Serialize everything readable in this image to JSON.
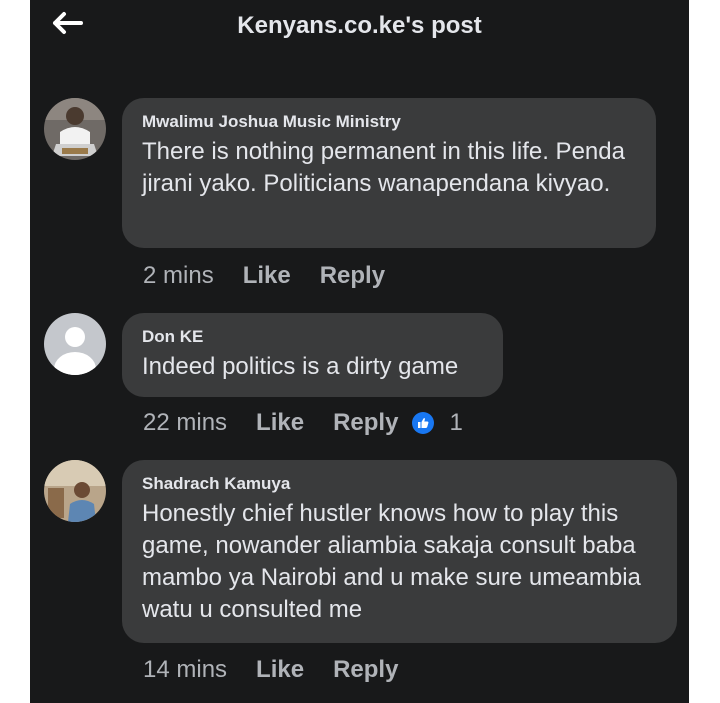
{
  "header": {
    "title": "Kenyans.co.ke's post"
  },
  "comments": [
    {
      "author": "Mwalimu Joshua Music Ministry",
      "text": "There is nothing permanent in this life. Penda jirani yako. Politicians wanapendana kivyao.",
      "time": "2 mins",
      "like_label": "Like",
      "reply_label": "Reply"
    },
    {
      "author": "Don KE",
      "text": "Indeed politics is a dirty game",
      "time": "22 mins",
      "like_label": "Like",
      "reply_label": "Reply",
      "reaction_icon": "like-reaction-icon",
      "reaction_count": "1"
    },
    {
      "author": "Shadrach Kamuya",
      "text": "Honestly chief hustler knows how to play this game, nowander aliambia sakaja consult baba mambo ya Nairobi and u make sure umeambia watu u consulted me",
      "time": "14 mins",
      "like_label": "Like",
      "reply_label": "Reply"
    }
  ],
  "colors": {
    "background": "#18191a",
    "bubble": "#3a3b3c",
    "primary_text": "#e4e6eb",
    "secondary_text": "#b0b3b8",
    "like_blue": "#1877f2"
  }
}
